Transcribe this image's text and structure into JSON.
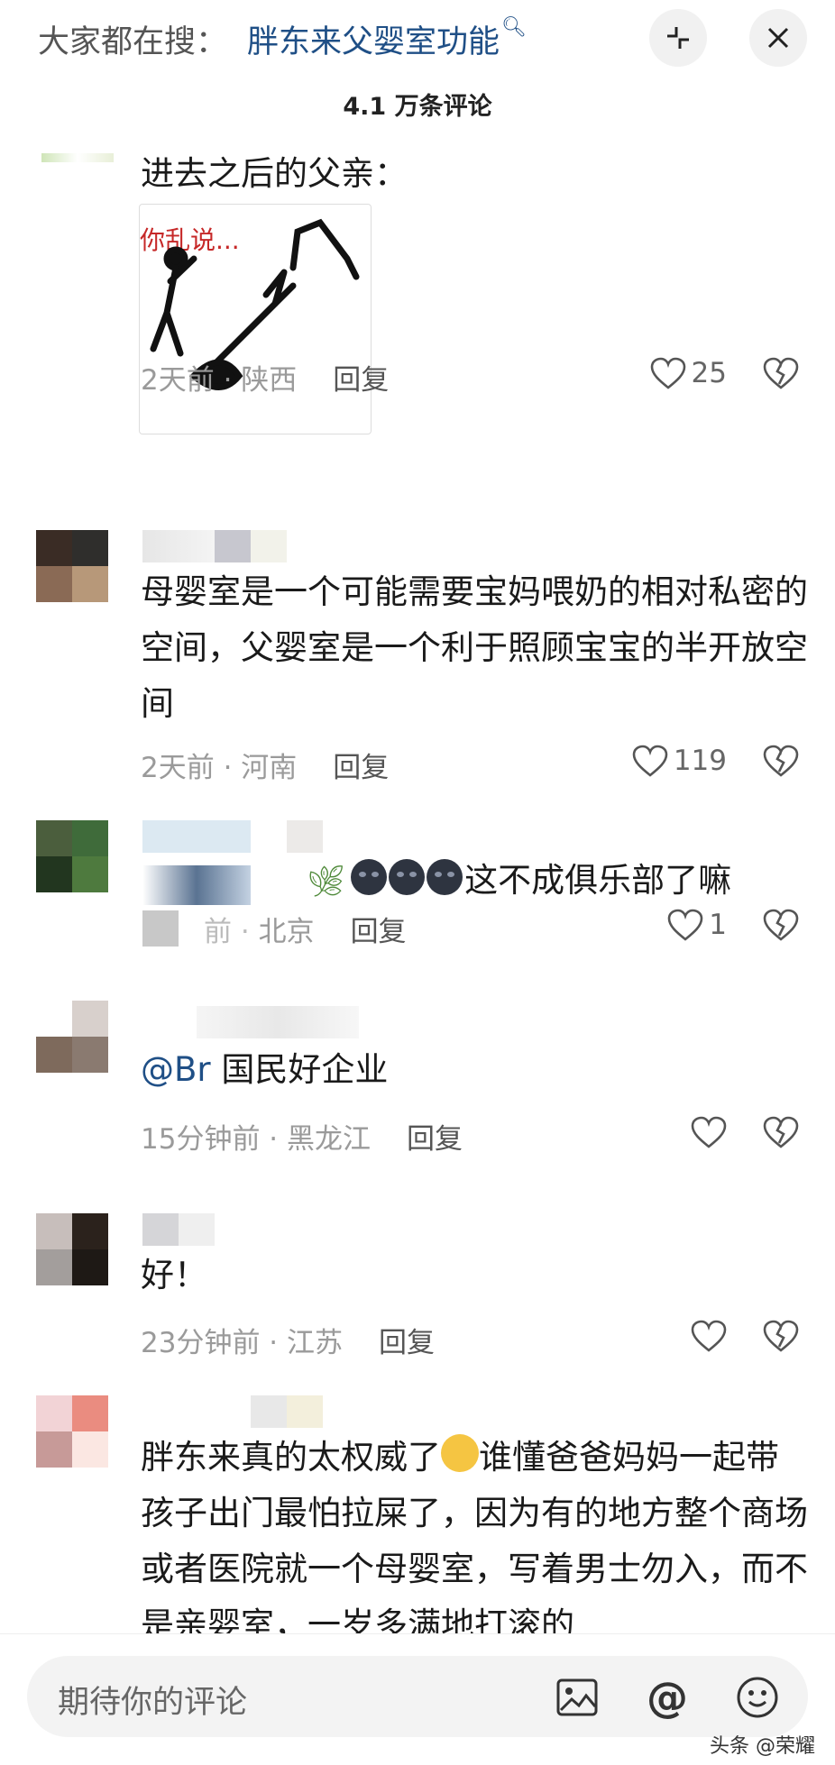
{
  "header": {
    "search_prefix": "大家都在搜：",
    "search_term": "胖东来父婴室功能",
    "comment_count": "4.1 万条评论"
  },
  "comments": [
    {
      "content": "进去之后的父亲：",
      "image_text": "你乱说...",
      "time": "2天前",
      "location": "陕西",
      "reply": "回复",
      "likes": "25"
    },
    {
      "content": "母婴室是一个可能需要宝妈喂奶的相对私密的空间，父婴室是一个利于照顾宝宝的半开放空间",
      "time": "2天前",
      "location": "河南",
      "reply": "回复",
      "likes": "119"
    },
    {
      "content": "这不成俱乐部了嘛",
      "time": "",
      "location": "北京",
      "reply": "回复",
      "likes": "1"
    },
    {
      "mention": "@Br",
      "content": "国民好企业",
      "time": "15分钟前",
      "location": "黑龙江",
      "reply": "回复",
      "likes": ""
    },
    {
      "content": "好！",
      "time": "23分钟前",
      "location": "江苏",
      "reply": "回复",
      "likes": ""
    },
    {
      "content_a": "胖东来真的太权威了",
      "content_b": "谁懂爸爸妈妈一起带孩子出门最怕拉屎了，因为有的地方整个商场或者医院就一个母婴室，写着男士勿入，而不是亲婴室，一岁多满地打滚的"
    }
  ],
  "footer": {
    "placeholder": "期待你的评论",
    "watermark": "头条 @荣耀"
  },
  "icons": {
    "collapse": "collapse-icon",
    "close": "close-icon",
    "heart": "heart-icon",
    "dislike": "broken-heart-icon",
    "image": "image-icon",
    "at": "at-icon",
    "emoji": "emoji-icon"
  }
}
